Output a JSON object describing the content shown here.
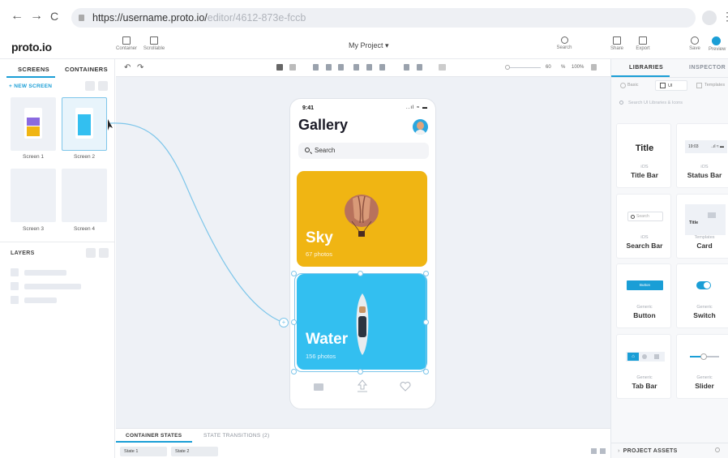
{
  "browser": {
    "back": "←",
    "forward": "→",
    "reload": "C",
    "url_main": "https://username.proto.io/",
    "url_dim": "editor/4612-873e-fccb"
  },
  "app": {
    "logo": "proto.io",
    "project_name": "My Project ▾",
    "tools_left": [
      {
        "label": "Container"
      },
      {
        "label": "Scrollable"
      }
    ],
    "tools_right": [
      {
        "label": "Search"
      },
      {
        "label": "Share"
      },
      {
        "label": "Export"
      },
      {
        "label": "Save"
      },
      {
        "label": "Preview"
      }
    ]
  },
  "left_panel": {
    "tabs": [
      "SCREENS",
      "CONTAINERS"
    ],
    "new_screen": "+ NEW SCREEN",
    "screens": [
      "Screen 1",
      "Screen 2",
      "Screen 3",
      "Screen 4"
    ],
    "layers_label": "LAYERS"
  },
  "canvas_toolbar": {
    "zoom_value": "60",
    "zoom_percent": "%",
    "zoom_fit": "100%"
  },
  "phone": {
    "time": "9:41",
    "status": "..ıl ≈ ▬",
    "title": "Gallery",
    "search_placeholder": "Search",
    "cards": [
      {
        "title": "Sky",
        "subtitle": "67 photos",
        "color": "#f0b513"
      },
      {
        "title": "Water",
        "subtitle": "156 photos",
        "color": "#33bff0"
      }
    ]
  },
  "right_panel": {
    "tabs": [
      "LIBRARIES",
      "INSPECTOR"
    ],
    "lib_tabs": [
      "Basic",
      "UI",
      "Templates"
    ],
    "search_placeholder": "Search UI Libraries & Icons",
    "tiles": [
      {
        "kind": "iOS",
        "name": "Title Bar",
        "preview": "Title"
      },
      {
        "kind": "iOS",
        "name": "Status Bar",
        "preview": "19:03"
      },
      {
        "kind": "iOS",
        "name": "Search Bar",
        "preview": "Search"
      },
      {
        "kind": "Templates",
        "name": "Card",
        "preview": "Title"
      },
      {
        "kind": "Generic",
        "name": "Button",
        "preview": "Button"
      },
      {
        "kind": "Generic",
        "name": "Switch",
        "preview": ""
      },
      {
        "kind": "Generic",
        "name": "Tab Bar",
        "preview": ""
      },
      {
        "kind": "Generic",
        "name": "Slider",
        "preview": ""
      }
    ],
    "project_assets": "PROJECT ASSETS"
  },
  "bottom": {
    "tabs": [
      "CONTAINER STATES",
      "STATE TRANSITIONS (2)"
    ],
    "states": [
      "State 1",
      "State 2"
    ]
  },
  "colors": {
    "accent": "#1a9ed6",
    "sky_card": "#f0b513",
    "water_card": "#33bff0",
    "canvas_bg": "#eef1f6"
  }
}
